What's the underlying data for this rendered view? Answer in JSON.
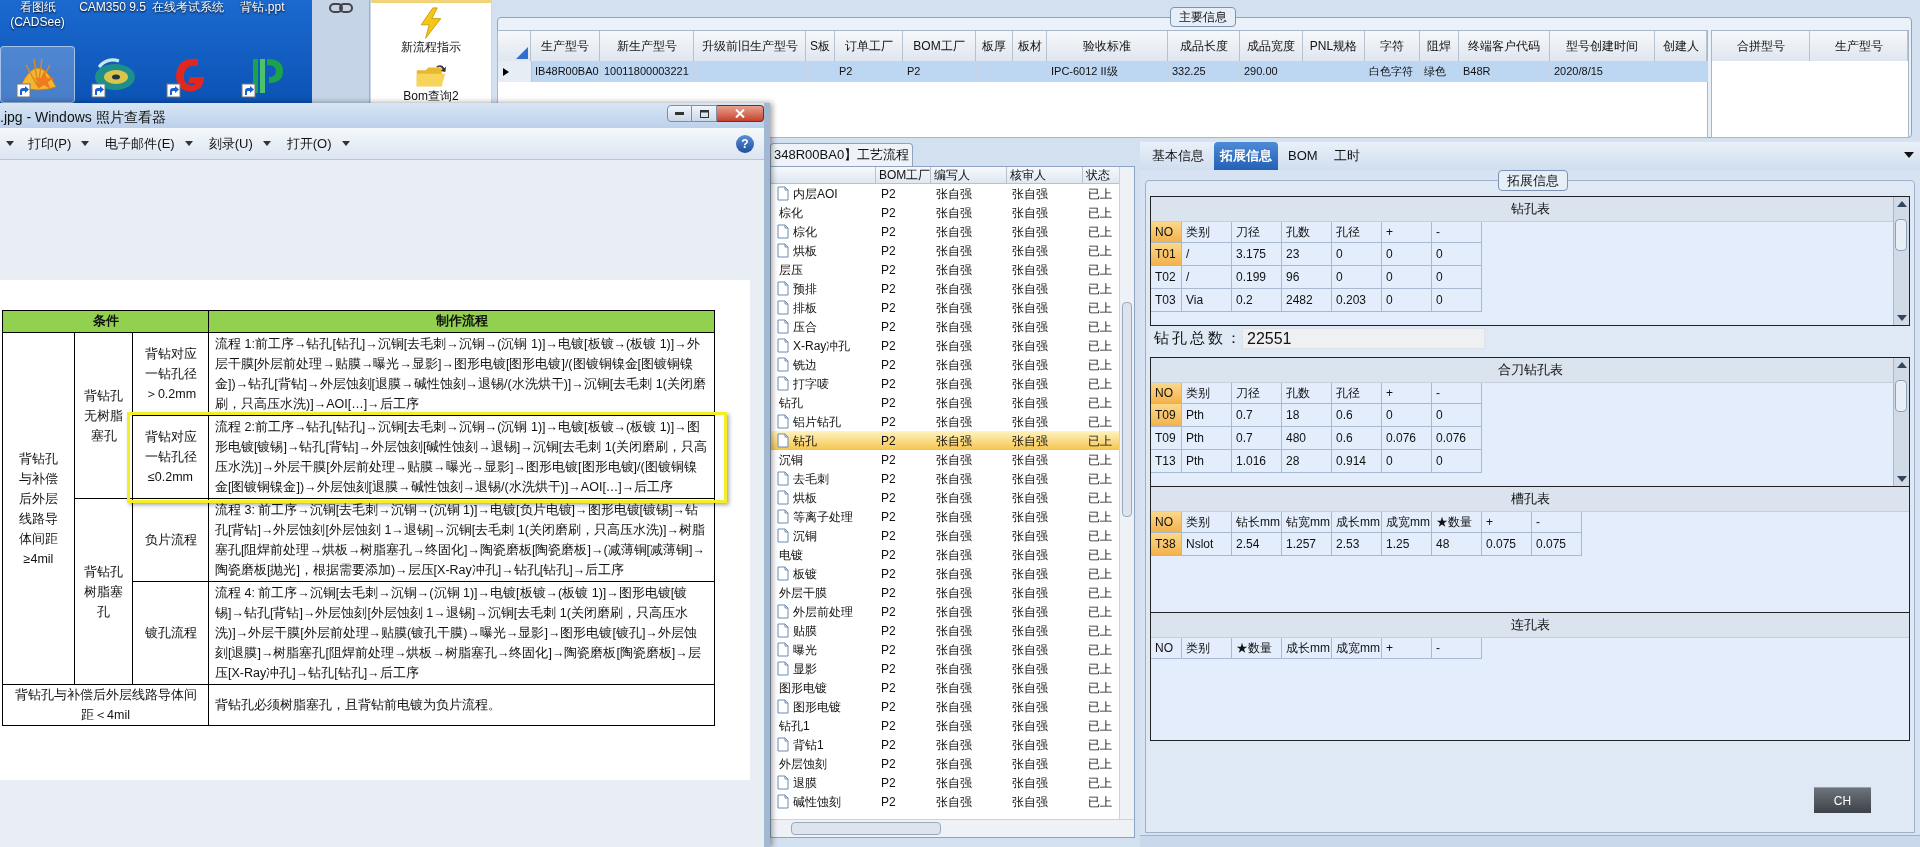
{
  "desktop": {
    "labels": [
      "看图纸 (CADSee)",
      "CAM350 9.5",
      "在线考试系统",
      "背钻.ppt"
    ],
    "icons": [
      {
        "kind": "shell",
        "selected": true
      },
      {
        "kind": "disc",
        "selected": false
      },
      {
        "kind": "swoosh",
        "selected": false
      },
      {
        "kind": "leaf",
        "selected": false
      }
    ]
  },
  "launcher": {
    "items": [
      {
        "kind": "bolt",
        "label": "新流程指示"
      },
      {
        "kind": "folder",
        "label": "Bom查询2"
      }
    ]
  },
  "main_info": {
    "legend": "主要信息",
    "columns": [
      "生产型号",
      "新生产型号",
      "升级前旧生产型号",
      "S板",
      "订单工厂",
      "BOM工厂",
      "板厚",
      "板材",
      "验收标准",
      "成品长度",
      "成品宽度",
      "PNL规格",
      "字符",
      "阻焊",
      "终端客户代码",
      "型号创建时间",
      "创建人"
    ],
    "rows": [
      {
        "selected": true,
        "cells": [
          "IB48R00BA0",
          "10011800003221",
          null,
          null,
          "P2",
          "P2",
          null,
          null,
          "IPC-6012 II级",
          "332.25",
          "290.00",
          null,
          "白色字符",
          "绿色",
          "B48R",
          "2020/8/15",
          null
        ]
      }
    ],
    "side_columns": [
      "合拼型号",
      "生产型号"
    ]
  },
  "photo_viewer": {
    "title": ".jpg - Windows 照片查看器",
    "menus": [
      "打印(P)",
      "电子邮件(E)",
      "刻录(U)",
      "打开(O)"
    ],
    "help": "?",
    "document": {
      "headers": [
        "条件",
        "制作流程"
      ],
      "groups": [
        {
          "condition": "背钻孔与补偿后外层线路导体间距≥4mil",
          "subgroups": [
            {
              "label": "背钻孔无树脂塞孔",
              "rows": [
                {
                  "case": "背钻对应一钻孔径＞0.2mm",
                  "flow": "流程 1:前工序→钻孔[钻孔]→沉铜[去毛刺→沉铜→(沉铜 1)]→电镀[板镀→(板镀 1)]→外层干膜[外层前处理→贴膜→曝光→显影]→图形电镀[图形电镀]/(图镀铜镍金[图镀铜镍金])→钻孔[背钻]→外层蚀刻[退膜→碱性蚀刻→退锡/(水洗烘干)]→沉铜[去毛刺 1(关闭磨刷，只高压水洗)]→AOI[…]→后工序",
                  "highlighted": false
                },
                {
                  "case": "背钻对应一钻孔径≤0.2mm",
                  "flow": "流程 2:前工序→钻孔[钻孔]→沉铜[去毛刺→沉铜→(沉铜 1)]→电镀[板镀→(板镀 1)]→图形电镀[镀锡]→钻孔[背钻]→外层蚀刻[碱性蚀刻→退锡]→沉铜[去毛刺 1(关闭磨刷，只高压水洗)]→外层干膜[外层前处理→贴膜→曝光→显影]→图形电镀[图形电镀]/(图镀铜镍金[图镀铜镍金])→外层蚀刻[退膜→碱性蚀刻→退锡/(水洗烘干)]→AOI[…]→后工序",
                  "highlighted": true
                }
              ]
            },
            {
              "label": "背钻孔树脂塞孔",
              "rows": [
                {
                  "case": "负片流程",
                  "flow": "流程 3: 前工序→沉铜[去毛刺→沉铜→(沉铜 1)]→电镀[负片电镀]→图形电镀[镀锡]→钻孔[背钻]→外层蚀刻[外层蚀刻 1→退锡]→沉铜[去毛刺 1(关闭磨刷，只高压水洗)]→树脂塞孔[阻焊前处理→烘板→树脂塞孔→终固化]→陶瓷磨板[陶瓷磨板]→(减薄铜[减薄铜]→陶瓷磨板[抛光]，根据需要添加)→层压[X-Ray冲孔]→钻孔[钻孔]→后工序",
                  "highlighted": false
                },
                {
                  "case": "镀孔流程",
                  "flow": "流程 4: 前工序→沉铜[去毛刺→沉铜→(沉铜 1)]→电镀[板镀→(板镀 1)]→图形电镀[镀锡]→钻孔[背钻]→外层蚀刻[外层蚀刻 1→退锡]→沉铜[去毛刺 1(关闭磨刷，只高压水洗)]→外层干膜[外层前处理→贴膜(镀孔干膜)→曝光→显影]→图形电镀[镀孔]→外层蚀刻[退膜]→树脂塞孔[阻焊前处理→烘板→树脂塞孔→终固化]→陶瓷磨板[陶瓷磨板]→层压[X-Ray冲孔]→钻孔[钻孔]→后工序",
                  "highlighted": false
                }
              ]
            }
          ]
        }
      ],
      "footer": {
        "condition": "背钻孔与补偿后外层线路导体间距＜4mil",
        "flow": "背钻孔必须树脂塞孔，且背钻前电镀为负片流程。"
      }
    }
  },
  "process": {
    "tab": "348R00BA0】工艺流程",
    "columns": [
      "BOM工厂",
      "编写人",
      "核审人",
      "状态"
    ],
    "nodes": [
      {
        "children": [
          {
            "label": "内层AOI",
            "factory": "P2",
            "writer": "张自强",
            "reviewer": "张自强",
            "status": "已上",
            "selected": false
          }
        ]
      },
      {
        "label": "棕化",
        "factory": "P2",
        "writer": "张自强",
        "reviewer": "张自强",
        "status": "已上",
        "selected": false,
        "children": [
          {
            "label": "棕化",
            "factory": "P2",
            "writer": "张自强",
            "reviewer": "张自强",
            "status": "已上",
            "selected": false
          },
          {
            "label": "烘板",
            "factory": "P2",
            "writer": "张自强",
            "reviewer": "张自强",
            "status": "已上",
            "selected": false
          }
        ]
      },
      {
        "label": "层压",
        "factory": "P2",
        "writer": "张自强",
        "reviewer": "张自强",
        "status": "已上",
        "selected": false,
        "children": [
          {
            "label": "预排",
            "factory": "P2",
            "writer": "张自强",
            "reviewer": "张自强",
            "status": "已上",
            "selected": false
          },
          {
            "label": "排板",
            "factory": "P2",
            "writer": "张自强",
            "reviewer": "张自强",
            "status": "已上",
            "selected": false
          },
          {
            "label": "压合",
            "factory": "P2",
            "writer": "张自强",
            "reviewer": "张自强",
            "status": "已上",
            "selected": false
          },
          {
            "label": "X-Ray冲孔",
            "factory": "P2",
            "writer": "张自强",
            "reviewer": "张自强",
            "status": "已上",
            "selected": false
          },
          {
            "label": "铣边",
            "factory": "P2",
            "writer": "张自强",
            "reviewer": "张自强",
            "status": "已上",
            "selected": false
          },
          {
            "label": "打字唛",
            "factory": "P2",
            "writer": "张自强",
            "reviewer": "张自强",
            "status": "已上",
            "selected": false
          }
        ]
      },
      {
        "label": "钻孔",
        "factory": "P2",
        "writer": "张自强",
        "reviewer": "张自强",
        "status": "已上",
        "selected": false,
        "children": [
          {
            "label": "铝片钻孔",
            "factory": "P2",
            "writer": "张自强",
            "reviewer": "张自强",
            "status": "已上",
            "selected": false
          },
          {
            "label": "钻孔",
            "factory": "P2",
            "writer": "张自强",
            "reviewer": "张自强",
            "status": "已上",
            "selected": true
          }
        ]
      },
      {
        "label": "沉铜",
        "factory": "P2",
        "writer": "张自强",
        "reviewer": "张自强",
        "status": "已上",
        "selected": false,
        "children": [
          {
            "label": "去毛刺",
            "factory": "P2",
            "writer": "张自强",
            "reviewer": "张自强",
            "status": "已上",
            "selected": false
          },
          {
            "label": "烘板",
            "factory": "P2",
            "writer": "张自强",
            "reviewer": "张自强",
            "status": "已上",
            "selected": false
          },
          {
            "label": "等离子处理",
            "factory": "P2",
            "writer": "张自强",
            "reviewer": "张自强",
            "status": "已上",
            "selected": false
          },
          {
            "label": "沉铜",
            "factory": "P2",
            "writer": "张自强",
            "reviewer": "张自强",
            "status": "已上",
            "selected": false
          }
        ]
      },
      {
        "label": "电镀",
        "factory": "P2",
        "writer": "张自强",
        "reviewer": "张自强",
        "status": "已上",
        "selected": false,
        "children": [
          {
            "label": "板镀",
            "factory": "P2",
            "writer": "张自强",
            "reviewer": "张自强",
            "status": "已上",
            "selected": false
          }
        ]
      },
      {
        "label": "外层干膜",
        "factory": "P2",
        "writer": "张自强",
        "reviewer": "张自强",
        "status": "已上",
        "selected": false,
        "children": [
          {
            "label": "外层前处理",
            "factory": "P2",
            "writer": "张自强",
            "reviewer": "张自强",
            "status": "已上",
            "selected": false
          },
          {
            "label": "贴膜",
            "factory": "P2",
            "writer": "张自强",
            "reviewer": "张自强",
            "status": "已上",
            "selected": false
          },
          {
            "label": "曝光",
            "factory": "P2",
            "writer": "张自强",
            "reviewer": "张自强",
            "status": "已上",
            "selected": false
          },
          {
            "label": "显影",
            "factory": "P2",
            "writer": "张自强",
            "reviewer": "张自强",
            "status": "已上",
            "selected": false
          }
        ]
      },
      {
        "label": "图形电镀",
        "factory": "P2",
        "writer": "张自强",
        "reviewer": "张自强",
        "status": "已上",
        "selected": false,
        "children": [
          {
            "label": "图形电镀",
            "factory": "P2",
            "writer": "张自强",
            "reviewer": "张自强",
            "status": "已上",
            "selected": false
          }
        ]
      },
      {
        "label": "钻孔1",
        "factory": "P2",
        "writer": "张自强",
        "reviewer": "张自强",
        "status": "已上",
        "selected": false,
        "children": [
          {
            "label": "背钻1",
            "factory": "P2",
            "writer": "张自强",
            "reviewer": "张自强",
            "status": "已上",
            "selected": false
          }
        ]
      },
      {
        "label": "外层蚀刻",
        "factory": "P2",
        "writer": "张自强",
        "reviewer": "张自强",
        "status": "已上",
        "selected": false,
        "children": [
          {
            "label": "退膜",
            "factory": "P2",
            "writer": "张自强",
            "reviewer": "张自强",
            "status": "已上",
            "selected": false
          },
          {
            "label": "碱性蚀刻",
            "factory": "P2",
            "writer": "张自强",
            "reviewer": "张自强",
            "status": "已上",
            "selected": false
          }
        ]
      }
    ]
  },
  "detail": {
    "tabs": [
      {
        "label": "基本信息",
        "selected": false
      },
      {
        "label": "拓展信息",
        "selected": true
      },
      {
        "label": "BOM",
        "selected": false
      },
      {
        "label": "工时",
        "selected": false
      }
    ],
    "legend": "拓展信息",
    "drill_table": {
      "title": "钻孔表",
      "columns": [
        "NO",
        "类别",
        "刀径",
        "孔数",
        "孔径",
        "+",
        "-"
      ],
      "rows": [
        {
          "selected": true,
          "cells": [
            "T01",
            "/",
            "3.175",
            "23",
            "0",
            "0",
            "0"
          ]
        },
        {
          "selected": false,
          "cells": [
            "T02",
            "/",
            "0.199",
            "96",
            "0",
            "0",
            "0"
          ]
        },
        {
          "selected": false,
          "cells": [
            "T03",
            "Via",
            "0.2",
            "2482",
            "0.203",
            "0",
            "0"
          ]
        }
      ]
    },
    "drill_total": {
      "label": "钻孔总数：",
      "value": "22551"
    },
    "combined_table": {
      "title": "合刀钻孔表",
      "columns": [
        "NO",
        "类别",
        "刀径",
        "孔数",
        "孔径",
        "+",
        "-"
      ],
      "rows": [
        {
          "selected": true,
          "cells": [
            "T09",
            "Pth",
            "0.7",
            "18",
            "0.6",
            "0",
            "0"
          ]
        },
        {
          "selected": false,
          "cells": [
            "T09",
            "Pth",
            "0.7",
            "480",
            "0.6",
            "0.076",
            "0.076"
          ]
        },
        {
          "selected": false,
          "cells": [
            "T13",
            "Pth",
            "1.016",
            "28",
            "0.914",
            "0",
            "0"
          ]
        }
      ]
    },
    "slot_table": {
      "title": "槽孔表",
      "columns": [
        "NO",
        "类别",
        "钻长mm",
        "钻宽mm",
        "成长mm",
        "成宽mm",
        "★数量",
        "+",
        "-"
      ],
      "rows": [
        {
          "selected": true,
          "cells": [
            "T38",
            "Nslot",
            "2.54",
            "1.257",
            "2.53",
            "1.25",
            "48",
            "0.075",
            "0.075"
          ]
        }
      ]
    },
    "link_table": {
      "title": "连孔表",
      "columns": [
        "NO",
        "类别",
        "★数量",
        "成长mm",
        "成宽mm",
        "+",
        "-"
      ]
    },
    "language": "CH"
  }
}
